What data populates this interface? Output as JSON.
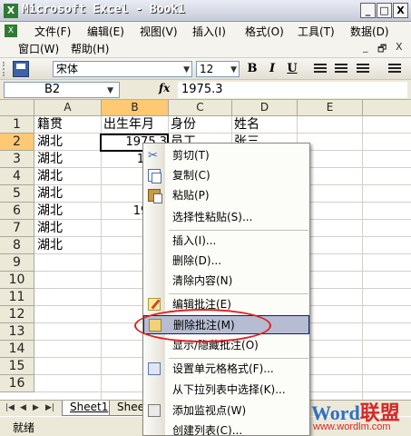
{
  "window": {
    "title": "Microsoft Excel - Book1",
    "app_icon": "excel-icon",
    "buttons": [
      "_",
      "□",
      "X"
    ]
  },
  "menubar": {
    "row1": [
      "文件(F)",
      "编辑(E)",
      "视图(V)",
      "插入(I)",
      "格式(O)",
      "工具(T)",
      "数据(D)"
    ],
    "row2": [
      "窗口(W)",
      "帮助(H)"
    ],
    "mdi_buttons": [
      "_",
      "🗗",
      "X"
    ]
  },
  "toolbar": {
    "font_name": "宋体",
    "font_size": "12",
    "bold": "B",
    "italic": "I",
    "underline": "U"
  },
  "formula_bar": {
    "name_box": "B2",
    "fx": "fx",
    "value": "1975.3"
  },
  "sheet": {
    "columns": [
      "A",
      "B",
      "C",
      "D",
      "E"
    ],
    "selected_column": "B",
    "rows": [
      "1",
      "2",
      "3",
      "4",
      "5",
      "6",
      "7",
      "8",
      "9",
      "10",
      "11",
      "12",
      "13",
      "14",
      "15",
      "16"
    ],
    "selected_row": "2",
    "cells": {
      "A1": "籍贯",
      "B1": "出生年月",
      "C1": "身份",
      "D1": "姓名",
      "A2": "湖北",
      "B2": "1975.3",
      "C2": "员工",
      "D2": "张三",
      "A3": "湖北",
      "B3": "1974",
      "A4": "湖北",
      "B4": "195",
      "A5": "湖北",
      "B5": "195",
      "A6": "湖北",
      "B6": "1962.",
      "A7": "湖北",
      "B7": "196",
      "A8": "湖北",
      "B8": "196"
    }
  },
  "sheet_tabs": [
    "Sheet1",
    "Sheet"
  ],
  "status": "就绪",
  "context_menu": {
    "items": [
      {
        "label": "剪切(T)",
        "icon": "scissors-icon"
      },
      {
        "label": "复制(C)",
        "icon": "copy-icon"
      },
      {
        "label": "粘贴(P)",
        "icon": "paste-icon"
      },
      {
        "label": "选择性粘贴(S)..."
      },
      {
        "label": "插入(I)..."
      },
      {
        "label": "删除(D)..."
      },
      {
        "label": "清除内容(N)"
      },
      {
        "label": "编辑批注(E)",
        "icon": "edit-comment-icon"
      },
      {
        "label": "删除批注(M)",
        "icon": "delete-comment-icon",
        "highlighted": true
      },
      {
        "label": "显示/隐藏批注(O)"
      },
      {
        "label": "设置单元格格式(F)...",
        "icon": "format-cells-icon"
      },
      {
        "label": "从下拉列表中选择(K)..."
      },
      {
        "label": "添加监视点(W)",
        "icon": "watch-icon"
      },
      {
        "label": "创建列表(C)..."
      }
    ]
  },
  "watermark": {
    "brand_blue": "Word",
    "brand_red": "联盟",
    "url": "www.wordlm.com"
  },
  "colors": {
    "selection_header": "#ffc873",
    "menu_highlight": "#b6bdd2",
    "annotation_red": "#e02020"
  }
}
